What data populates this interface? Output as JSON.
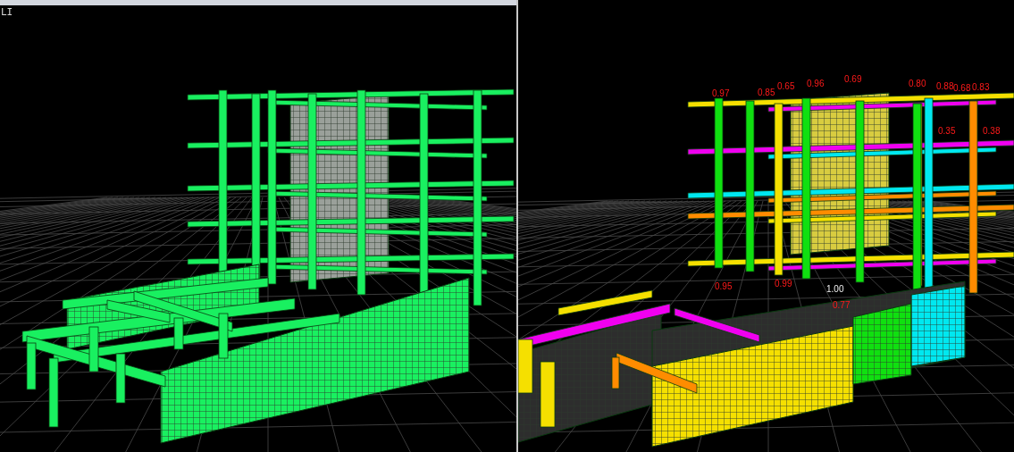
{
  "left_view": {
    "label": "LI"
  },
  "right_view": {
    "ratio_labels": [
      "0.97",
      "0.85",
      "0.65",
      "0.96",
      "0.69",
      "0.80",
      "0.88",
      "0.68",
      "0.83",
      "0.35",
      "0.38",
      "0.95",
      "0.99",
      "1.00",
      "0.77"
    ]
  }
}
